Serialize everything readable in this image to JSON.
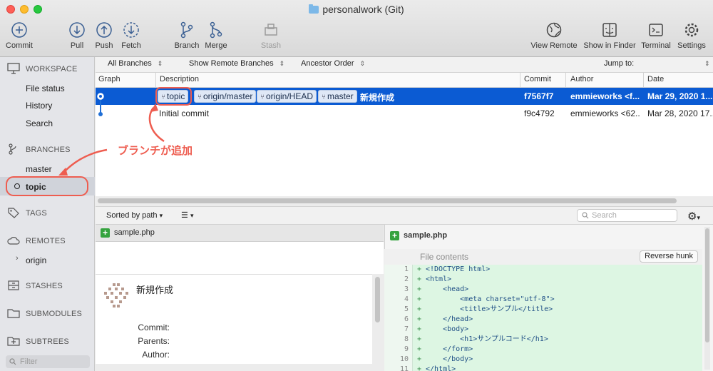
{
  "window": {
    "title": "personalwork (Git)"
  },
  "toolbar": {
    "commit": "Commit",
    "pull": "Pull",
    "push": "Push",
    "fetch": "Fetch",
    "branch": "Branch",
    "merge": "Merge",
    "stash": "Stash",
    "view_remote": "View Remote",
    "show_in_finder": "Show in Finder",
    "terminal": "Terminal",
    "settings": "Settings"
  },
  "sidebar": {
    "workspace": "WORKSPACE",
    "workspace_items": [
      "File status",
      "History",
      "Search"
    ],
    "branches": "BRANCHES",
    "branch_items": [
      "master",
      "topic"
    ],
    "tags": "TAGS",
    "remotes": "REMOTES",
    "remote_items": [
      "origin"
    ],
    "stashes": "STASHES",
    "submodules": "SUBMODULES",
    "subtrees": "SUBTREES",
    "filter_placeholder": "Filter"
  },
  "filterbar": {
    "branches": "All Branches",
    "remote": "Show Remote Branches",
    "order": "Ancestor Order",
    "jump": "Jump to:"
  },
  "table": {
    "headers": [
      "Graph",
      "Description",
      "Commit",
      "Author",
      "Date"
    ],
    "rows": [
      {
        "labels": [
          "topic",
          "origin/master",
          "origin/HEAD",
          "master"
        ],
        "description": "新規作成",
        "commit": "f7567f7",
        "author": "emmieworks <f...",
        "date": "Mar 29, 2020 1..."
      },
      {
        "labels": [],
        "description": "Initial commit",
        "commit": "f9c4792",
        "author": "emmieworks <62...",
        "date": "Mar 28, 2020 17..."
      }
    ]
  },
  "annotation": {
    "text": "ブランチが追加",
    "color": "#ee5d50"
  },
  "bottom": {
    "sort": "Sorted by path",
    "search_placeholder": "Search",
    "file": "sample.php",
    "commit_message": "新規作成",
    "meta_labels": [
      "Commit:",
      "Parents:",
      "Author:"
    ]
  },
  "diff": {
    "file": "sample.php",
    "hunk_title": "File contents",
    "reverse_hunk": "Reverse hunk",
    "lines": [
      {
        "n": "1",
        "t": "<!DOCTYPE html>"
      },
      {
        "n": "2",
        "t": "<html>"
      },
      {
        "n": "3",
        "t": "    <head>"
      },
      {
        "n": "4",
        "t": "        <meta charset=\"utf-8\">"
      },
      {
        "n": "5",
        "t": "        <title>サンプル</title>"
      },
      {
        "n": "6",
        "t": "    </head>"
      },
      {
        "n": "7",
        "t": "    <body>"
      },
      {
        "n": "8",
        "t": "        <h1>サンプルコード</h1>"
      },
      {
        "n": "9",
        "t": "    </form>"
      },
      {
        "n": "10",
        "t": "    </body>"
      },
      {
        "n": "11",
        "t": "</html>"
      }
    ]
  },
  "colors": {
    "selection": "#0b5bd3",
    "accent": "#ee5d50",
    "added": "#ddf6e3"
  }
}
